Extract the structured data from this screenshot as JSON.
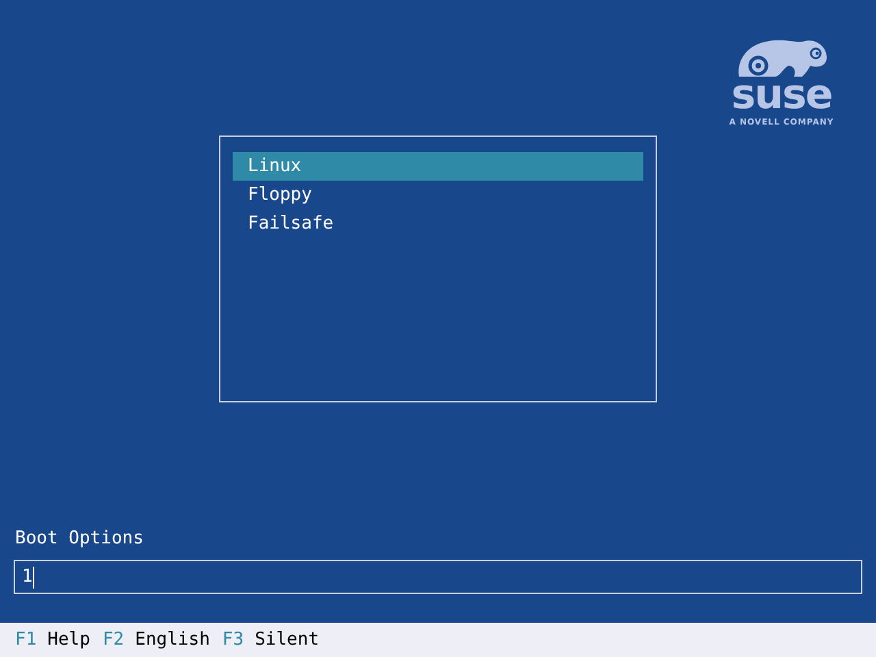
{
  "logo": {
    "wordmark": "suse",
    "tagline": "A NOVELL COMPANY"
  },
  "boot_menu": {
    "items": [
      {
        "label": "Linux",
        "selected": true
      },
      {
        "label": "Floppy",
        "selected": false
      },
      {
        "label": "Failsafe",
        "selected": false
      }
    ]
  },
  "boot_options": {
    "label": "Boot Options",
    "value": "1"
  },
  "function_keys": [
    {
      "key": "F1",
      "label": "Help"
    },
    {
      "key": "F2",
      "label": "English"
    },
    {
      "key": "F3",
      "label": "Silent"
    }
  ]
}
